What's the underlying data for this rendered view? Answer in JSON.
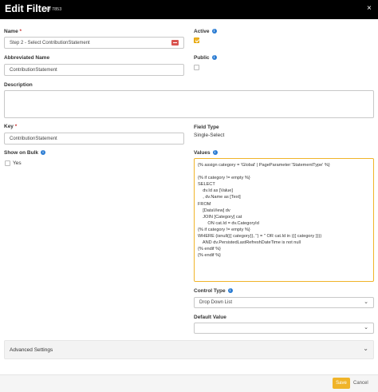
{
  "header": {
    "title": "Edit Filter",
    "id_label": "kit 7853",
    "close_glyph": "×"
  },
  "fields": {
    "name": {
      "label": "Name",
      "required": "*",
      "value": "Step 2 - Select ContributionStatement"
    },
    "abbrev": {
      "label": "Abbreviated Name",
      "value": "ContributionStatement"
    },
    "description": {
      "label": "Description",
      "value": ""
    },
    "key": {
      "label": "Key",
      "required": "*",
      "value": "ContributionStatement"
    },
    "show_on_bulk": {
      "label": "Show on Bulk",
      "option": "Yes",
      "checked": false
    },
    "active": {
      "label": "Active",
      "checked": true
    },
    "public": {
      "label": "Public",
      "checked": false
    },
    "field_type": {
      "label": "Field Type",
      "value": "Single-Select"
    },
    "values": {
      "label": "Values",
      "lines": [
        "{% assign category = 'Global' | PageParameter:'StatementType' %}",
        "",
        "{% if category != empty %}",
        "SELECT",
        "    dv.Id as [Value]",
        "    , dv.Name as [Text]",
        "FROM",
        "    [DataView] dv",
        "    JOIN [Category] cat",
        "        ON cat.Id = dv.CategoryId",
        "{% if category != empty %}",
        "WHERE (isnull({{ category}}, '') = '' OR cat.Id in ({{ category }}))",
        "    AND dv.PersistedLastRefreshDateTime is not null",
        "{% endif %}",
        "{% endif %}"
      ]
    },
    "control_type": {
      "label": "Control Type",
      "value": "Drop Down List"
    },
    "default_value": {
      "label": "Default Value",
      "value": ""
    }
  },
  "advanced": {
    "label": "Advanced Settings"
  },
  "footer": {
    "save": "Save",
    "cancel": "Cancel"
  },
  "colors": {
    "accent": "#f0b429",
    "header_bg": "#000000",
    "info": "#2b7cd3",
    "required": "#c9302c"
  }
}
